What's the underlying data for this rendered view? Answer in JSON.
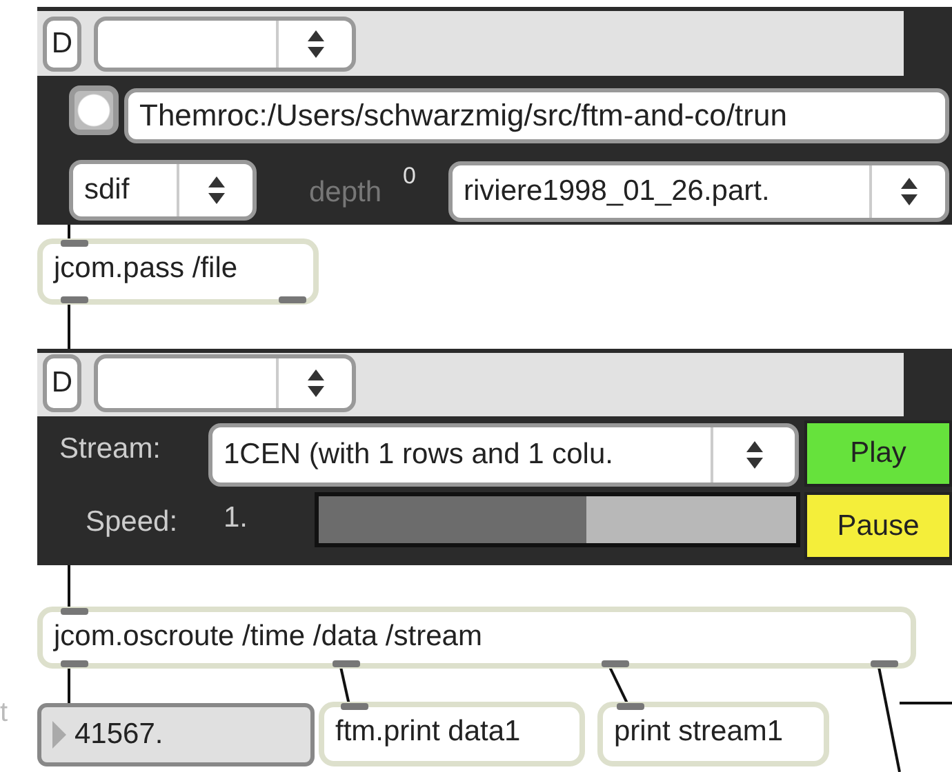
{
  "edge_text": "t",
  "file_module": {
    "d_button": "D",
    "toggle": {
      "on": false
    },
    "path": "Themroc:/Users/schwarzmig/src/ftm-and-co/trun",
    "format_menu": "sdif",
    "depth_label": "depth",
    "depth_value": "0",
    "file_menu": "riviere1998_01_26.part."
  },
  "player_module": {
    "d_button": "D",
    "stream_label": "Stream:",
    "stream_menu": "1CEN (with 1 rows and 1 colu.",
    "play_button": "Play",
    "speed_label": "Speed:",
    "speed_value": "1.",
    "speed_slider": {
      "level": 0.56
    },
    "pause_button": "Pause"
  },
  "objects": [
    {
      "kind": "object",
      "text": "jcom.pass /file"
    },
    {
      "kind": "object",
      "text": "jcom.oscroute /time /data /stream"
    },
    {
      "kind": "number",
      "text": "41567."
    },
    {
      "kind": "object",
      "text": "ftm.print data1"
    },
    {
      "kind": "object",
      "text": "print stream1"
    }
  ]
}
